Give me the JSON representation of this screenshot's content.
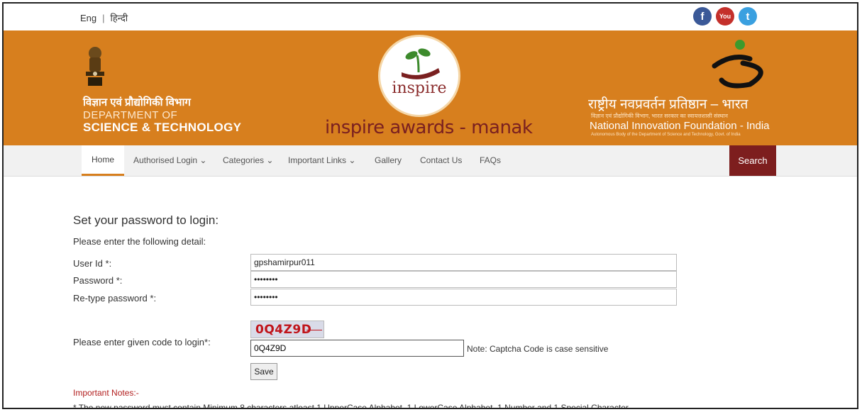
{
  "top_bar": {
    "lang_en": "Eng",
    "lang_sep": "|",
    "lang_hi": "हिन्दी",
    "social": [
      {
        "icon": "facebook-icon",
        "glyph": "f"
      },
      {
        "icon": "youtube-icon",
        "glyph": "You"
      },
      {
        "icon": "twitter-icon",
        "glyph": "t"
      }
    ]
  },
  "header": {
    "dept_hindi": "विज्ञान एवं प्रौद्योगिकी विभाग",
    "dept_line1": "DEPARTMENT OF",
    "dept_line2": "SCIENCE & TECHNOLOGY",
    "inspire_word": "inspire",
    "awards_title": "inspire awards - manak",
    "nif_hindi": "राष्ट्रीय नवप्रवर्तन प्रतिष्ठान – भारत",
    "nif_hindi_sub": "विज्ञान एवं प्रौद्योगिकी विभाग, भारत सरकार का स्वायत्तशासी संस्थान",
    "nif_english": "National Innovation Foundation - India",
    "nif_tiny": "Autonomous Body of the Department of Science and Technology, Govt. of India"
  },
  "nav": {
    "home": "Home",
    "authorised_login": "Authorised Login ⌄",
    "categories": "Categories ⌄",
    "important_links": "Important Links ⌄",
    "gallery": "Gallery",
    "contact": "Contact Us",
    "faqs": "FAQs",
    "search": "Search"
  },
  "form": {
    "title": "Set your password to login:",
    "subtitle": "Please enter the following detail:",
    "user_id_label": "User Id *:",
    "user_id_value": "gpshamirpur011",
    "password_label": "Password *:",
    "password_value": "password",
    "retype_label": "Re-type password *:",
    "retype_value": "password",
    "captcha_label": "Please enter given code to login*:",
    "captcha_image_text": "0Q4Z9D",
    "captcha_value": "0Q4Z9D",
    "captcha_note": "Note: Captcha Code is case sensitive",
    "save_label": "Save",
    "important_heading": "Important Notes:-",
    "rule_text": "* The new password must contain Minimum 8 characters atleast 1 UpperCase Alphabet, 1 LowerCase Alphabet, 1 Number and 1 Special Character"
  },
  "colors": {
    "header_orange": "#d77f1e",
    "search_maroon": "#7d1e1e",
    "important_red": "#b21f1f"
  }
}
